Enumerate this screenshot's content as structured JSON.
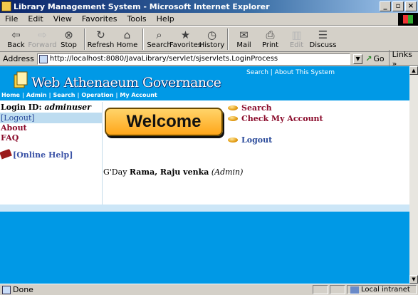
{
  "window": {
    "title": "Library Management System - Microsoft Internet Explorer",
    "minimize": "_",
    "maximize": "▫",
    "close": "×"
  },
  "menu": [
    "File",
    "Edit",
    "View",
    "Favorites",
    "Tools",
    "Help"
  ],
  "toolbar": [
    {
      "label": "Back",
      "icon": "back-arrow-icon",
      "glyph": "⇦",
      "enabled": true
    },
    {
      "label": "Forward",
      "icon": "forward-arrow-icon",
      "glyph": "⇨",
      "enabled": false
    },
    {
      "label": "Stop",
      "icon": "stop-icon",
      "glyph": "⊗",
      "enabled": true
    },
    {
      "label": "Refresh",
      "icon": "refresh-icon",
      "glyph": "↻",
      "enabled": true
    },
    {
      "label": "Home",
      "icon": "home-icon",
      "glyph": "⌂",
      "enabled": true
    },
    {
      "label": "Search",
      "icon": "search-icon",
      "glyph": "⌕",
      "enabled": true
    },
    {
      "label": "Favorites",
      "icon": "favorites-icon",
      "glyph": "★",
      "enabled": true
    },
    {
      "label": "History",
      "icon": "history-icon",
      "glyph": "◷",
      "enabled": true
    },
    {
      "label": "Mail",
      "icon": "mail-icon",
      "glyph": "✉",
      "enabled": true
    },
    {
      "label": "Print",
      "icon": "print-icon",
      "glyph": "⎙",
      "enabled": true
    },
    {
      "label": "Edit",
      "icon": "edit-icon",
      "glyph": "▥",
      "enabled": false
    },
    {
      "label": "Discuss",
      "icon": "discuss-icon",
      "glyph": "☰",
      "enabled": true
    }
  ],
  "address": {
    "label": "Address",
    "url": "http://localhost:8080/JavaLibrary/servlet/sjservlets.LoginProcess",
    "go_label": "Go",
    "links_label": "Links »"
  },
  "site": {
    "logo_text": "Web Athenaeum Governance",
    "top_links": "Search  |  About This System",
    "nav": [
      "Home",
      "Admin",
      "Search",
      "Operation",
      "My Account"
    ]
  },
  "sidebar": {
    "login_prefix": "Login ID: ",
    "login_user": "adminuser",
    "logout": "[Logout]",
    "links": [
      "About",
      "FAQ"
    ],
    "help": "[Online Help]"
  },
  "main": {
    "welcome": "Welcome",
    "links": [
      "Search",
      "Check My Account",
      "Logout"
    ],
    "greeting_prefix": "G'Day ",
    "greeting_name": "Rama, Raju venka",
    "greeting_role": "(Admin)"
  },
  "status": {
    "text": "Done",
    "zone": "Local intranet"
  }
}
